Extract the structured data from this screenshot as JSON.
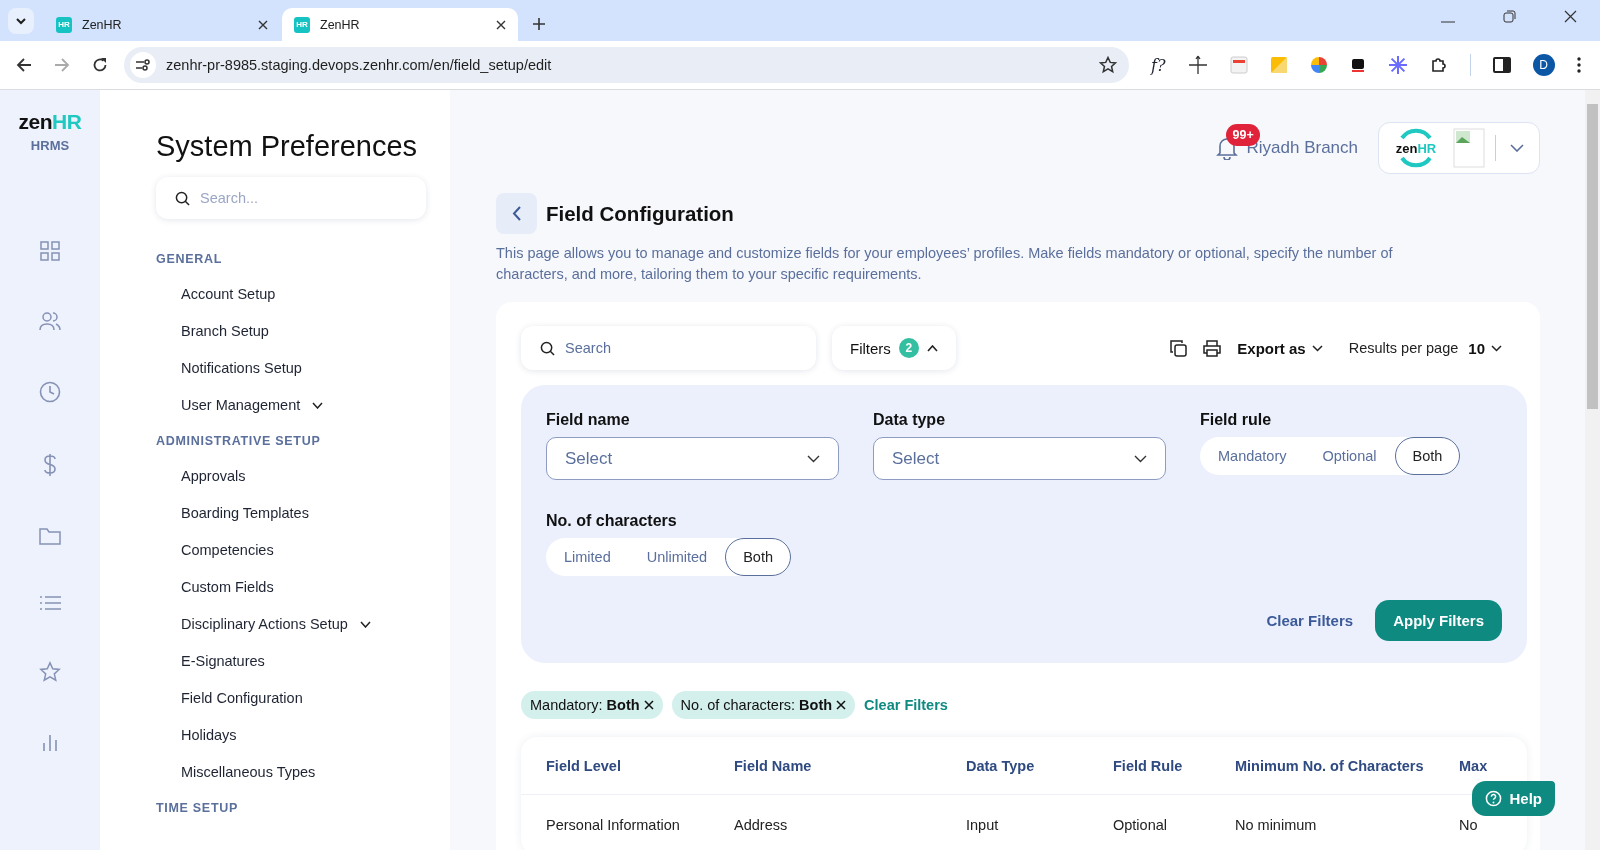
{
  "browser": {
    "tabs": [
      {
        "favicon": "HR",
        "title": "ZenHR",
        "selected": false
      },
      {
        "favicon": "HR",
        "title": "ZenHR",
        "selected": true
      }
    ],
    "url": "zenhr-pr-8985.staging.devops.zenhr.com/en/field_setup/edit",
    "extension_label": "f?",
    "profile": "D"
  },
  "rail": {
    "logo": {
      "part_1": "zen",
      "part_2": "HR"
    },
    "subtitle": "HRMS"
  },
  "sidebar": {
    "title": "System Preferences",
    "search": {
      "placeholder": "Search..."
    },
    "sections": [
      {
        "heading": "GENERAL",
        "items": [
          {
            "label": "Account Setup"
          },
          {
            "label": "Branch Setup"
          },
          {
            "label": "Notifications Setup"
          },
          {
            "label": "User Management",
            "expanded": false
          }
        ]
      },
      {
        "heading": "ADMINISTRATIVE SETUP",
        "items": [
          {
            "label": "Approvals"
          },
          {
            "label": "Boarding Templates"
          },
          {
            "label": "Competencies"
          },
          {
            "label": "Custom Fields"
          },
          {
            "label": "Disciplinary Actions Setup",
            "expanded": false
          },
          {
            "label": "E-Signatures"
          },
          {
            "label": "Field Configuration"
          },
          {
            "label": "Holidays"
          },
          {
            "label": "Miscellaneous Types"
          }
        ]
      },
      {
        "heading": "TIME SETUP"
      }
    ]
  },
  "header": {
    "notifications": "99+",
    "branch": "Riyadh Branch",
    "company_logo": {
      "part_1": "zen",
      "part_2": "HR"
    }
  },
  "page": {
    "title": "Field Configuration",
    "description": "This page allows you to manage and customize fields for your employees’ profiles. Make fields mandatory or optional, specify the number of characters, and more, tailoring them to your specific requirements."
  },
  "toolbar": {
    "search": {
      "placeholder": "Search"
    },
    "filters": {
      "label": "Filters",
      "count": "2",
      "expanded": true
    },
    "export": "Export as",
    "results_label": "Results per page",
    "results_value": "10"
  },
  "filters": [
    {
      "kind": "select",
      "label": "Field name",
      "placeholder": "Select"
    },
    {
      "kind": "select",
      "label": "Data type",
      "placeholder": "Select"
    },
    {
      "kind": "segmented",
      "label": "Field rule",
      "options": [
        {
          "label": "Mandatory",
          "selected": false
        },
        {
          "label": "Optional",
          "selected": false
        },
        {
          "label": "Both",
          "selected": true
        }
      ]
    },
    {
      "kind": "segmented",
      "label": "No. of characters",
      "options": [
        {
          "label": "Limited",
          "selected": false
        },
        {
          "label": "Unlimited",
          "selected": false
        },
        {
          "label": "Both",
          "selected": true
        }
      ]
    }
  ],
  "filter_actions": {
    "clear": "Clear Filters",
    "apply": "Apply Filters"
  },
  "chips": [
    "Mandatory: **Both**",
    "No. of characters: **Both**"
  ],
  "chips_clear": "Clear Filters",
  "table": {
    "columns": [
      "Field Level",
      "Field Name",
      "Data Type",
      "Field Rule",
      "Minimum No. of Characters",
      "Max"
    ],
    "rows": [
      [
        "Personal Information",
        "Address",
        "Input",
        "Optional",
        "No minimum",
        "No"
      ]
    ]
  },
  "help": "Help"
}
